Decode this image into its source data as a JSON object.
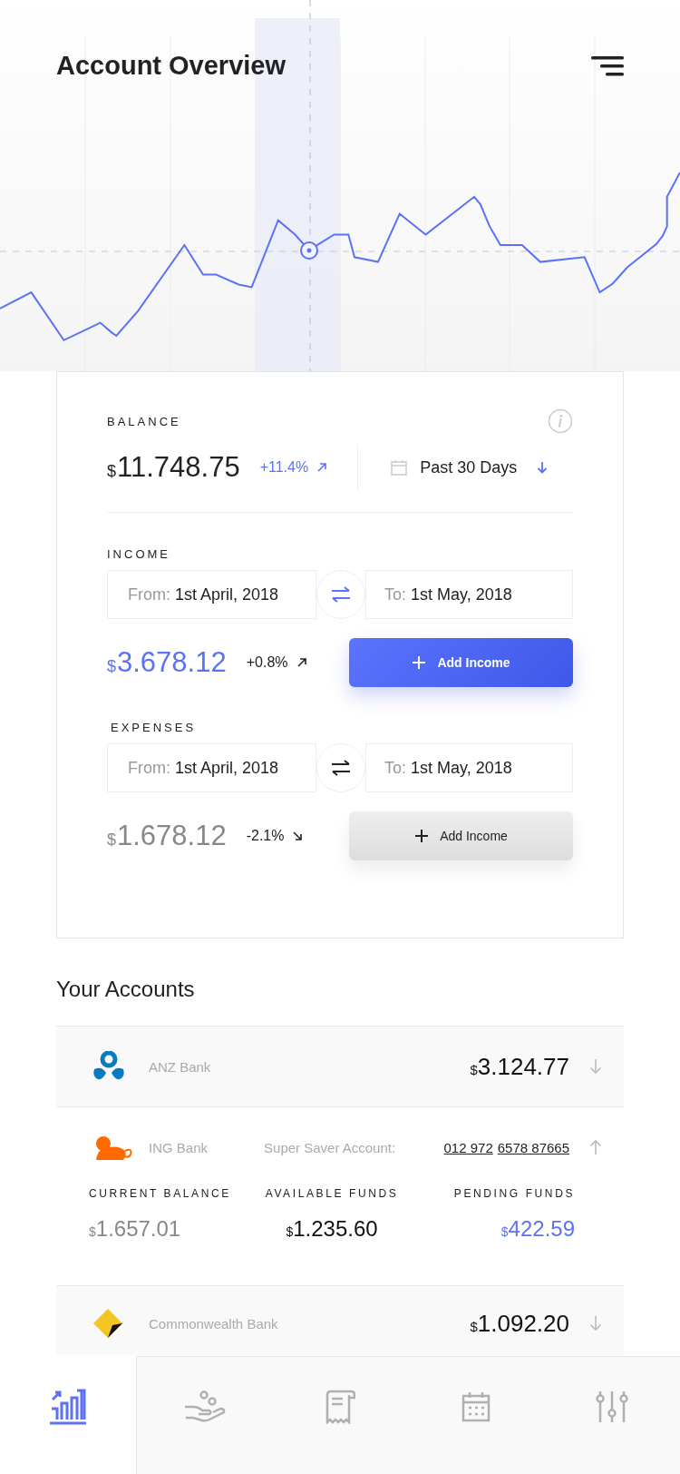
{
  "header": {
    "title": "Account Overview"
  },
  "balance": {
    "label": "BALANCE",
    "currency": "$",
    "amount": "11.748.75",
    "change": "+11.4%",
    "rising": true,
    "period": "Past 30 Days"
  },
  "sections": [
    {
      "kind": "income",
      "label": "INCOME",
      "from_label": "From:",
      "from": "1st April, 2018",
      "to_label": "To:",
      "to": "1st May, 2018",
      "currency": "$",
      "amount": "3.678.12",
      "change": "+0.8%",
      "rising": true,
      "button": "Add Income",
      "highlighted": true
    },
    {
      "kind": "expenses",
      "label": "EXPENSES",
      "from_label": "From:",
      "from": "1st April, 2018",
      "to_label": "To:",
      "to": "1st May, 2018",
      "currency": "$",
      "amount": "1.678.12",
      "change": "-2.1%",
      "rising": false,
      "button": "Add Income",
      "highlighted": false
    }
  ],
  "accounts": {
    "title": "Your Accounts",
    "items": [
      {
        "kind": "anz",
        "name": "ANZ Bank",
        "currency": "$",
        "balance": "3.124.77",
        "expanded": false
      },
      {
        "kind": "ing",
        "name": "ING Bank",
        "account_label": "Super Saver Account:",
        "account_number": [
          "012 972",
          "6578 87665"
        ],
        "expanded": true,
        "details": [
          {
            "label": "CURRENT BALANCE",
            "currency": "$",
            "amount": "1.657.01",
            "kind": "muted"
          },
          {
            "label": "AVAILABLE FUNDS",
            "currency": "$",
            "amount": "1.235.60",
            "kind": "plain"
          },
          {
            "label": "PENDING FUNDS",
            "currency": "$",
            "amount": "422.59",
            "kind": "accent"
          }
        ]
      },
      {
        "kind": "cba",
        "name": "Commonwealth Bank",
        "currency": "$",
        "balance": "1.092.20",
        "expanded": false
      }
    ]
  },
  "nav": [
    {
      "kind": "stats",
      "selected": true
    },
    {
      "kind": "payments",
      "selected": false
    },
    {
      "kind": "bills",
      "selected": false
    },
    {
      "kind": "calendar",
      "selected": false
    },
    {
      "kind": "settings",
      "selected": false
    }
  ]
}
